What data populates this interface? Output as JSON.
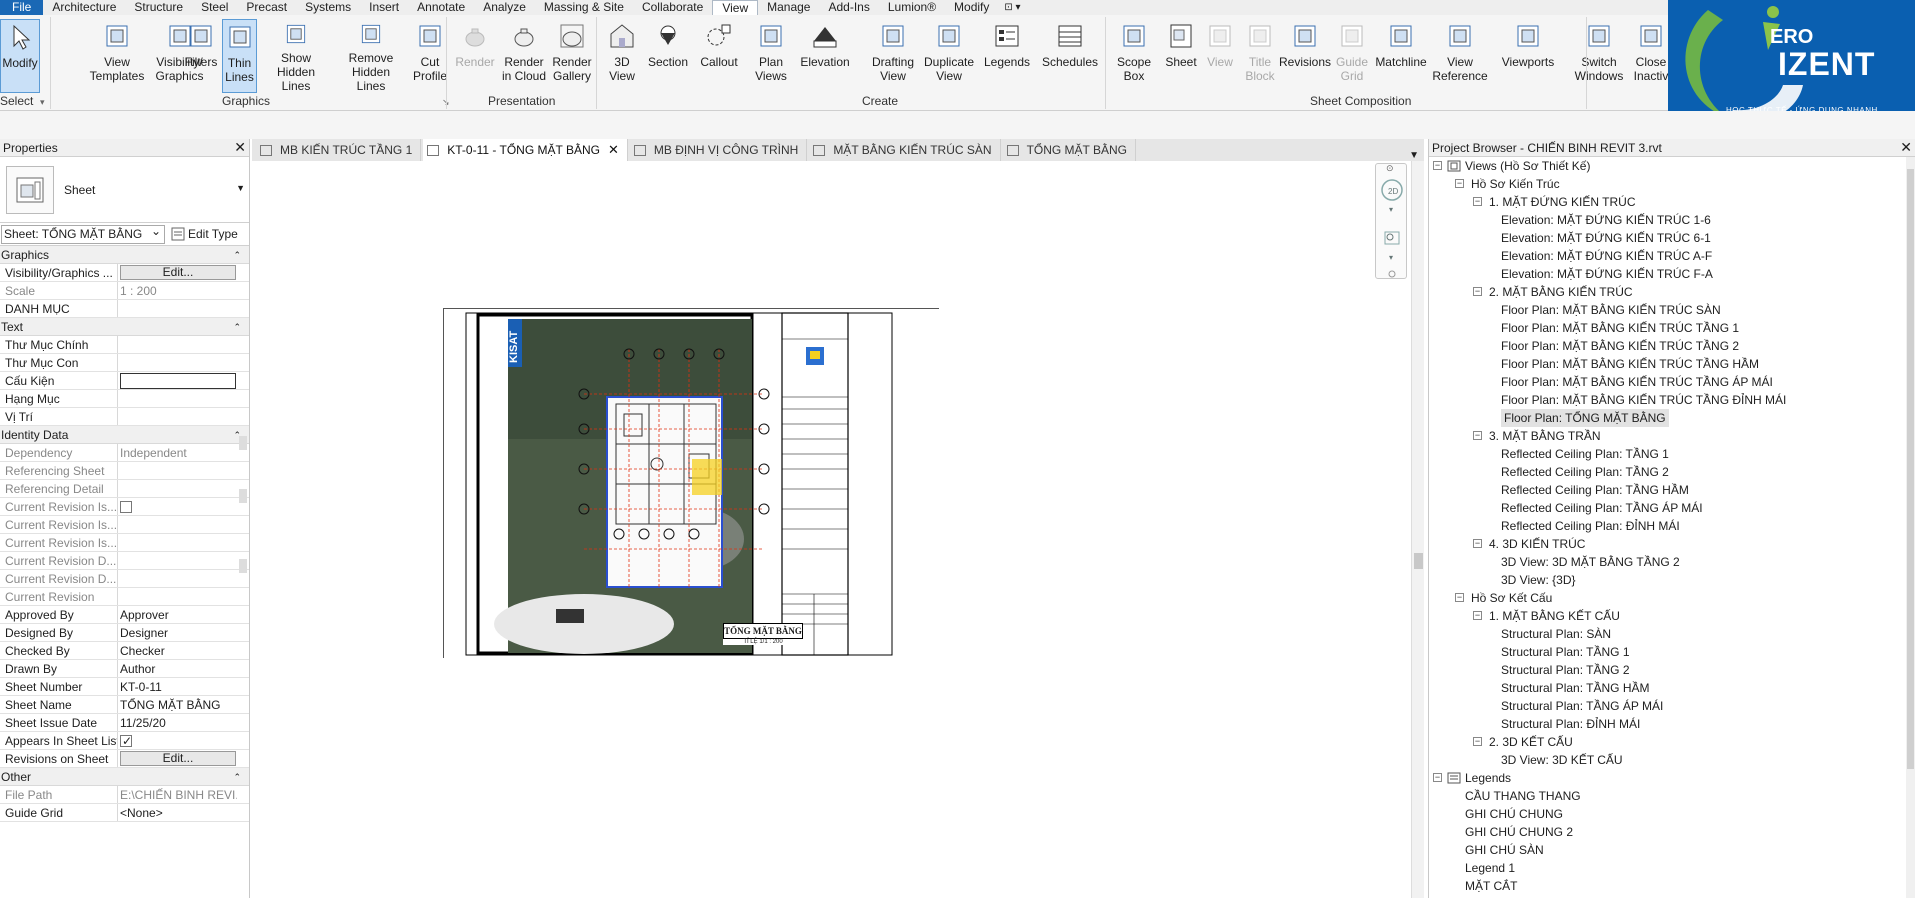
{
  "menu": {
    "tabs": [
      "File",
      "Architecture",
      "Structure",
      "Steel",
      "Precast",
      "Systems",
      "Insert",
      "Annotate",
      "Analyze",
      "Massing & Site",
      "Collaborate",
      "View",
      "Manage",
      "Add-Ins",
      "Lumion®",
      "Modify"
    ],
    "active_tab": "View"
  },
  "ribbon": {
    "buttons": [
      {
        "id": "modify",
        "label": "Modify",
        "icon": "cursor-icon",
        "state": "active"
      },
      {
        "id": "view-templates",
        "label": "View\nTemplates",
        "icon": "view-templates-icon",
        "state": "normal"
      },
      {
        "id": "visibility-graphics",
        "label": "Visibility/\nGraphics",
        "icon": "visibility-graphics-icon",
        "state": "normal"
      },
      {
        "id": "filters",
        "label": "Filters",
        "icon": "filters-icon",
        "state": "normal"
      },
      {
        "id": "thin-lines",
        "label": "Thin\nLines",
        "icon": "thin-lines-icon",
        "state": "active"
      },
      {
        "id": "show-hidden-lines",
        "label": "Show\nHidden Lines",
        "icon": "show-hidden-lines-icon",
        "state": "normal"
      },
      {
        "id": "remove-hidden-lines",
        "label": "Remove\nHidden Lines",
        "icon": "remove-hidden-lines-icon",
        "state": "normal"
      },
      {
        "id": "cut-profile",
        "label": "Cut\nProfile",
        "icon": "cut-profile-icon",
        "state": "normal"
      },
      {
        "id": "render",
        "label": "Render",
        "icon": "teapot-icon",
        "state": "disabled"
      },
      {
        "id": "render-in-cloud",
        "label": "Render\nin Cloud",
        "icon": "teapot-cloud-icon",
        "state": "normal"
      },
      {
        "id": "render-gallery",
        "label": "Render\nGallery",
        "icon": "teapot-gallery-icon",
        "state": "normal"
      },
      {
        "id": "3d-view",
        "label": "3D\nView",
        "icon": "house-3d-icon",
        "state": "normal"
      },
      {
        "id": "section",
        "label": "Section",
        "icon": "section-icon",
        "state": "normal"
      },
      {
        "id": "callout",
        "label": "Callout",
        "icon": "callout-icon",
        "state": "normal"
      },
      {
        "id": "plan-views",
        "label": "Plan\nViews",
        "icon": "plan-views-icon",
        "state": "normal"
      },
      {
        "id": "elevation",
        "label": "Elevation",
        "icon": "elevation-icon",
        "state": "normal"
      },
      {
        "id": "drafting-view",
        "label": "Drafting\nView",
        "icon": "drafting-view-icon",
        "state": "normal"
      },
      {
        "id": "duplicate-view",
        "label": "Duplicate\nView",
        "icon": "duplicate-view-icon",
        "state": "normal"
      },
      {
        "id": "legends",
        "label": "Legends",
        "icon": "legends-icon",
        "state": "normal"
      },
      {
        "id": "schedules",
        "label": "Schedules",
        "icon": "schedules-icon",
        "state": "normal"
      },
      {
        "id": "scope-box",
        "label": "Scope\nBox",
        "icon": "scope-box-icon",
        "state": "normal"
      },
      {
        "id": "sheet",
        "label": "Sheet",
        "icon": "sheet-icon",
        "state": "normal"
      },
      {
        "id": "view",
        "label": "View",
        "icon": "view-place-icon",
        "state": "disabled"
      },
      {
        "id": "title-block",
        "label": "Title\nBlock",
        "icon": "title-block-icon",
        "state": "disabled"
      },
      {
        "id": "revisions",
        "label": "Revisions",
        "icon": "revisions-icon",
        "state": "normal"
      },
      {
        "id": "guide-grid",
        "label": "Guide\nGrid",
        "icon": "guide-grid-icon",
        "state": "disabled"
      },
      {
        "id": "matchline",
        "label": "Matchline",
        "icon": "matchline-icon",
        "state": "normal"
      },
      {
        "id": "view-reference",
        "label": "View\nReference",
        "icon": "view-reference-icon",
        "state": "normal"
      },
      {
        "id": "viewports",
        "label": "Viewports",
        "icon": "viewports-icon",
        "state": "normal"
      },
      {
        "id": "switch-windows",
        "label": "Switch\nWindows",
        "icon": "switch-windows-icon",
        "state": "normal"
      },
      {
        "id": "close-inactive",
        "label": "Close\nInactiv",
        "icon": "close-inactive-icon",
        "state": "normal"
      }
    ],
    "groups": [
      {
        "id": "select",
        "label": "Select"
      },
      {
        "id": "graphics",
        "label": "Graphics"
      },
      {
        "id": "presentation",
        "label": "Presentation"
      },
      {
        "id": "create",
        "label": "Create"
      },
      {
        "id": "sheet-composition",
        "label": "Sheet Composition"
      }
    ]
  },
  "logo": {
    "ero": "ERO",
    "brand": "IZENT",
    "tagline": "HỌC THỰC TẾ - ỨNG DỤNG NHANH",
    "color": "#0a5fb0"
  },
  "properties": {
    "title": "Properties",
    "type_name": "Sheet",
    "selector": "Sheet: TỔNG MẶT BẰNG",
    "edit_type": "Edit Type",
    "groups": [
      {
        "name": "Graphics",
        "rows": [
          {
            "name": "Visibility/Graphics ...",
            "value": "Edit...",
            "kind": "button",
            "ro": false
          },
          {
            "name": "Scale",
            "value": "1 : 200",
            "kind": "text",
            "ro": true
          },
          {
            "name": "DANH MỤC",
            "value": "",
            "kind": "text",
            "ro": false
          }
        ]
      },
      {
        "name": "Text",
        "rows": [
          {
            "name": "Thư Mục Chính",
            "value": "",
            "kind": "text",
            "ro": false
          },
          {
            "name": "Thư Mục Con",
            "value": "",
            "kind": "text",
            "ro": false
          },
          {
            "name": "Cấu Kiện",
            "value": "",
            "kind": "box",
            "ro": false
          },
          {
            "name": "Hạng Mục",
            "value": "",
            "kind": "text",
            "ro": false
          },
          {
            "name": "Vị Trí",
            "value": "",
            "kind": "text",
            "ro": false
          }
        ]
      },
      {
        "name": "Identity Data",
        "rows": [
          {
            "name": "Dependency",
            "value": "Independent",
            "kind": "text",
            "ro": true
          },
          {
            "name": "Referencing Sheet",
            "value": "",
            "kind": "text",
            "ro": true
          },
          {
            "name": "Referencing Detail",
            "value": "",
            "kind": "text",
            "ro": true
          },
          {
            "name": "Current Revision Is...",
            "value": "",
            "kind": "check-off",
            "ro": true
          },
          {
            "name": "Current Revision Is...",
            "value": "",
            "kind": "text",
            "ro": true
          },
          {
            "name": "Current Revision Is...",
            "value": "",
            "kind": "text",
            "ro": true
          },
          {
            "name": "Current Revision D...",
            "value": "",
            "kind": "text",
            "ro": true
          },
          {
            "name": "Current Revision D...",
            "value": "",
            "kind": "text",
            "ro": true
          },
          {
            "name": "Current Revision",
            "value": "",
            "kind": "text",
            "ro": true
          },
          {
            "name": "Approved By",
            "value": "Approver",
            "kind": "text",
            "ro": false
          },
          {
            "name": "Designed By",
            "value": "Designer",
            "kind": "text",
            "ro": false
          },
          {
            "name": "Checked By",
            "value": "Checker",
            "kind": "text",
            "ro": false
          },
          {
            "name": "Drawn By",
            "value": "Author",
            "kind": "text",
            "ro": false
          },
          {
            "name": "Sheet Number",
            "value": "KT-0-11",
            "kind": "text",
            "ro": false
          },
          {
            "name": "Sheet Name",
            "value": "TỔNG MẶT BẰNG",
            "kind": "text",
            "ro": false
          },
          {
            "name": "Sheet Issue Date",
            "value": "11/25/20",
            "kind": "text",
            "ro": false
          },
          {
            "name": "Appears In Sheet List",
            "value": "",
            "kind": "check-on",
            "ro": false
          },
          {
            "name": "Revisions on Sheet",
            "value": "Edit...",
            "kind": "button",
            "ro": false
          }
        ]
      },
      {
        "name": "Other",
        "rows": [
          {
            "name": "File Path",
            "value": "E:\\CHIẾN BINH REVI...",
            "kind": "text",
            "ro": true
          },
          {
            "name": "Guide Grid",
            "value": "<None>",
            "kind": "text",
            "ro": false
          }
        ]
      }
    ]
  },
  "view_tabs": [
    {
      "label": "MB KIẾN TRÚC TẦNG 1",
      "active": false,
      "closable": false
    },
    {
      "label": "KT-0-11 - TỔNG MẶT BẰNG",
      "active": true,
      "closable": true
    },
    {
      "label": "MB ĐỊNH VỊ CÔNG TRÌNH",
      "active": false,
      "closable": false
    },
    {
      "label": "MẶT BẰNG KIẾN TRÚC SÀN",
      "active": false,
      "closable": false
    },
    {
      "label": "TỔNG MẶT BẰNG",
      "active": false,
      "closable": false
    }
  ],
  "sheet": {
    "side_label": "KISAT",
    "title_stamp": "TỔNG MẶT BẰNG",
    "scale_stamp": "TỈ LỆ 1/1 : 200"
  },
  "browser": {
    "title": "Project Browser - CHIẾN BINH REVIT 3.rvt",
    "nodes": [
      {
        "label": "Views (Hồ Sơ Thiết Kế)",
        "level": 0,
        "toggle": "-",
        "icon": "views"
      },
      {
        "label": "Hồ Sơ Kiến Trúc",
        "level": 1,
        "toggle": "-"
      },
      {
        "label": "1. MẶT ĐỨNG KIẾN TRÚC",
        "level": 2,
        "toggle": "-"
      },
      {
        "label": "Elevation: MẶT ĐỨNG KIẾN TRÚC 1-6",
        "level": 3
      },
      {
        "label": "Elevation: MẶT ĐỨNG KIẾN TRÚC 6-1",
        "level": 3
      },
      {
        "label": "Elevation: MẶT ĐỨNG KIẾN TRÚC A-F",
        "level": 3
      },
      {
        "label": "Elevation: MẶT ĐỨNG KIẾN TRÚC F-A",
        "level": 3
      },
      {
        "label": "2. MẶT BẰNG KIẾN TRÚC",
        "level": 2,
        "toggle": "-"
      },
      {
        "label": "Floor Plan: MẶT BẰNG KIẾN TRÚC SÀN",
        "level": 3
      },
      {
        "label": "Floor Plan: MẶT BẰNG KIẾN TRÚC TẦNG 1",
        "level": 3
      },
      {
        "label": "Floor Plan: MẶT BẰNG KIẾN TRÚC TẦNG 2",
        "level": 3
      },
      {
        "label": "Floor Plan: MẶT BẰNG KIẾN TRÚC TẦNG HẦM",
        "level": 3
      },
      {
        "label": "Floor Plan: MẶT BẰNG KIẾN TRÚC TẦNG ÁP MÁI",
        "level": 3
      },
      {
        "label": "Floor Plan: MẶT BẰNG KIẾN TRÚC TẦNG ĐỈNH MÁI",
        "level": 3
      },
      {
        "label": "Floor Plan: TỔNG MẶT BẰNG",
        "level": 3,
        "selected": true
      },
      {
        "label": "3. MẶT BẰNG TRẦN",
        "level": 2,
        "toggle": "-"
      },
      {
        "label": "Reflected Ceiling Plan: TẦNG 1",
        "level": 3
      },
      {
        "label": "Reflected Ceiling Plan: TẦNG 2",
        "level": 3
      },
      {
        "label": "Reflected Ceiling Plan: TẦNG HẦM",
        "level": 3
      },
      {
        "label": "Reflected Ceiling Plan: TẦNG ÁP MÁI",
        "level": 3
      },
      {
        "label": "Reflected Ceiling Plan: ĐỈNH MÁI",
        "level": 3
      },
      {
        "label": "4. 3D KIẾN TRÚC",
        "level": 2,
        "toggle": "-"
      },
      {
        "label": "3D View: 3D MẶT BẰNG TẦNG 2",
        "level": 3
      },
      {
        "label": "3D View: {3D}",
        "level": 3
      },
      {
        "label": "Hồ Sơ Kết Cấu",
        "level": 1,
        "toggle": "-"
      },
      {
        "label": "1. MẶT BẰNG KẾT CẤU",
        "level": 2,
        "toggle": "-"
      },
      {
        "label": "Structural Plan: SÀN",
        "level": 3
      },
      {
        "label": "Structural Plan: TẦNG 1",
        "level": 3
      },
      {
        "label": "Structural Plan: TẦNG 2",
        "level": 3
      },
      {
        "label": "Structural Plan: TẦNG HẦM",
        "level": 3
      },
      {
        "label": "Structural Plan: TẦNG ÁP MÁI",
        "level": 3
      },
      {
        "label": "Structural Plan: ĐỈNH MÁI",
        "level": 3
      },
      {
        "label": "2. 3D KẾT CẤU",
        "level": 2,
        "toggle": "-"
      },
      {
        "label": "3D View: 3D KẾT CẤU",
        "level": 3
      },
      {
        "label": "Legends",
        "level": 0,
        "toggle": "-",
        "icon": "legends"
      },
      {
        "label": "CẦU THANG THANG",
        "level": 1
      },
      {
        "label": "GHI CHÚ CHUNG",
        "level": 1
      },
      {
        "label": "GHI CHÚ CHUNG 2",
        "level": 1
      },
      {
        "label": "GHI CHÚ SÀN",
        "level": 1
      },
      {
        "label": "Legend 1",
        "level": 1
      },
      {
        "label": "MẶT CẮT",
        "level": 1
      }
    ]
  }
}
